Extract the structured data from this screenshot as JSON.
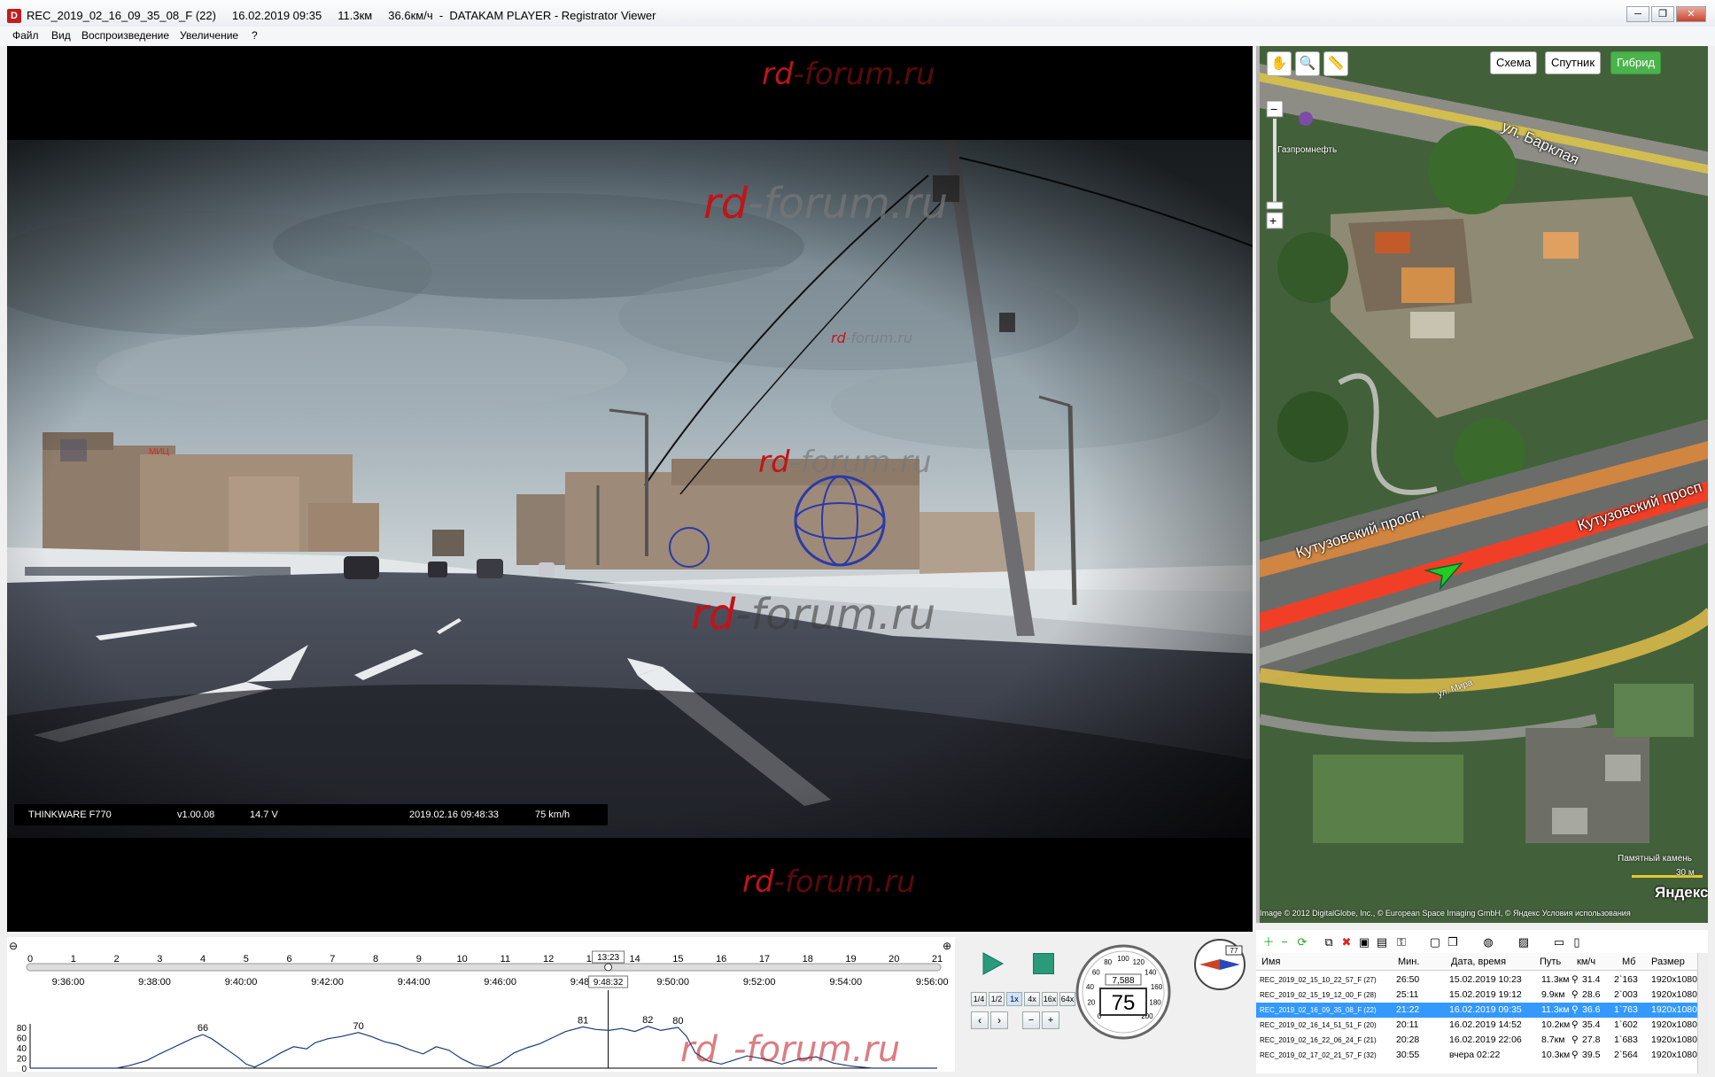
{
  "window": {
    "title": "REC_2019_02_16_09_35_08_F (22)     16.02.2019 09:35     11.3км     36.6км/ч  -  DATAKAM PLAYER - Registrator Viewer",
    "icon_letter": "D"
  },
  "menu": [
    "Файл",
    "Вид",
    "Воспроизведение",
    "Увеличение",
    "?"
  ],
  "video": {
    "watermark": {
      "red": "rd",
      "rest": "-forum.ru"
    },
    "osd": {
      "model": "THINKWARE F770",
      "firmware": "v1.00.08",
      "voltage": "14.7 V",
      "datetime": "2019.02.16 09:48:33",
      "speed": "75 km/h"
    }
  },
  "map": {
    "buttons": {
      "scheme": "Схема",
      "satellite": "Спутник",
      "hybrid": "Гибрид"
    },
    "labels": {
      "street1": "ул. Барклая",
      "street2": "Кутузовский просп.",
      "street3": "Кутузовский просп",
      "street4": "ул. Мира",
      "poi1": "Газпромнефть",
      "poi2": "Памятный камень",
      "scale": "30 м",
      "brand": "Яндекс",
      "copyright": "Image © 2012 DigitalGlobe, Inc., © European Space Imaging GmbH, © Яндекс  Условия использования"
    },
    "heading_color": "#22cc22",
    "route_color": "#ff3b1f"
  },
  "timeline": {
    "minute_ticks": [
      "0",
      "1",
      "2",
      "3",
      "4",
      "5",
      "6",
      "7",
      "8",
      "9",
      "10",
      "11",
      "12",
      "13",
      "14",
      "15",
      "16",
      "17",
      "18",
      "19",
      "20",
      "21"
    ],
    "current_marker": "13:23",
    "time_labels": [
      "9:36:00",
      "9:38:00",
      "9:40:00",
      "9:42:00",
      "9:44:00",
      "9:46:00",
      "9:48:00",
      "9:50:00",
      "9:52:00",
      "9:54:00",
      "9:56:00"
    ],
    "current_time": "9:48:32",
    "y_ticks": [
      "80",
      "60",
      "40",
      "20",
      "0"
    ],
    "peaks": [
      {
        "minute": 4.0,
        "speed": 66
      },
      {
        "minute": 7.6,
        "speed": 70
      },
      {
        "minute": 12.8,
        "speed": 81
      },
      {
        "minute": 14.3,
        "speed": 82
      },
      {
        "minute": 15.0,
        "speed": 80
      }
    ],
    "speed_profile": [
      [
        0,
        0
      ],
      [
        2.0,
        0
      ],
      [
        2.3,
        5
      ],
      [
        2.7,
        15
      ],
      [
        3.0,
        28
      ],
      [
        3.3,
        40
      ],
      [
        3.6,
        52
      ],
      [
        3.8,
        60
      ],
      [
        4.0,
        66
      ],
      [
        4.2,
        58
      ],
      [
        4.5,
        40
      ],
      [
        4.8,
        22
      ],
      [
        5.0,
        8
      ],
      [
        5.2,
        2
      ],
      [
        5.5,
        15
      ],
      [
        5.8,
        30
      ],
      [
        6.1,
        42
      ],
      [
        6.4,
        38
      ],
      [
        6.6,
        50
      ],
      [
        6.9,
        58
      ],
      [
        7.2,
        62
      ],
      [
        7.6,
        70
      ],
      [
        7.9,
        62
      ],
      [
        8.2,
        52
      ],
      [
        8.5,
        46
      ],
      [
        8.8,
        36
      ],
      [
        9.1,
        28
      ],
      [
        9.4,
        42
      ],
      [
        9.7,
        35
      ],
      [
        10.0,
        18
      ],
      [
        10.3,
        6
      ],
      [
        10.6,
        2
      ],
      [
        10.9,
        12
      ],
      [
        11.2,
        30
      ],
      [
        11.5,
        40
      ],
      [
        11.8,
        48
      ],
      [
        12.1,
        60
      ],
      [
        12.4,
        72
      ],
      [
        12.8,
        81
      ],
      [
        13.1,
        76
      ],
      [
        13.4,
        74
      ],
      [
        13.7,
        78
      ],
      [
        14.0,
        72
      ],
      [
        14.3,
        82
      ],
      [
        14.6,
        74
      ],
      [
        15.0,
        80
      ],
      [
        15.2,
        62
      ],
      [
        15.4,
        30
      ],
      [
        15.7,
        14
      ],
      [
        16.0,
        8
      ],
      [
        16.3,
        16
      ],
      [
        16.6,
        24
      ],
      [
        17.0,
        18
      ],
      [
        17.4,
        8
      ],
      [
        17.8,
        18
      ],
      [
        18.2,
        22
      ],
      [
        18.6,
        10
      ],
      [
        19.0,
        4
      ],
      [
        19.5,
        0
      ],
      [
        21.0,
        0
      ]
    ]
  },
  "controls": {
    "speeds": [
      "1/4",
      "1/2",
      "1x",
      "4x",
      "16x",
      "64x"
    ],
    "speedometer_value": "75",
    "odometer": "7,588",
    "dial_ticks": [
      "0",
      "20",
      "40",
      "60",
      "80",
      "100",
      "120",
      "140",
      "160",
      "180",
      "200"
    ],
    "compass_value": "77"
  },
  "filelist": {
    "headers": [
      "Имя",
      "Мин.",
      "Дата, время",
      "Путь",
      "км/ч",
      "Мб",
      "Размер"
    ],
    "rows": [
      {
        "name": "REC_2019_02_15_10_22_57_F (27)",
        "min": "26:50",
        "date": "15.02.2019 10:23",
        "path": "11.3км",
        "speed": "31.4",
        "mb": "2`163",
        "size": "1920x1080",
        "selected": false
      },
      {
        "name": "REC_2019_02_15_19_12_00_F (28)",
        "min": "25:11",
        "date": "15.02.2019 19:12",
        "path": "9.9км",
        "speed": "28.6",
        "mb": "2`003",
        "size": "1920x1080",
        "selected": false
      },
      {
        "name": "REC_2019_02_16_09_35_08_F (22)",
        "min": "21:22",
        "date": "16.02.2019 09:35",
        "path": "11.3км",
        "speed": "36.6",
        "mb": "1`763",
        "size": "1920x1080",
        "selected": true
      },
      {
        "name": "REC_2019_02_16_14_51_51_F (20)",
        "min": "20:11",
        "date": "16.02.2019 14:52",
        "path": "10.2км",
        "speed": "35.4",
        "mb": "1`602",
        "size": "1920x1080",
        "selected": false
      },
      {
        "name": "REC_2019_02_16_22_06_24_F (21)",
        "min": "20:28",
        "date": "16.02.2019 22:06",
        "path": "8.7км",
        "speed": "27.8",
        "mb": "1`683",
        "size": "1920x1080",
        "selected": false
      },
      {
        "name": "REC_2019_02_17_02_21_57_F (32)",
        "min": "30:55",
        "date": "вчера 02:22",
        "path": "10.3км",
        "speed": "39.5",
        "mb": "2`564",
        "size": "1920x1080",
        "selected": false
      }
    ]
  }
}
